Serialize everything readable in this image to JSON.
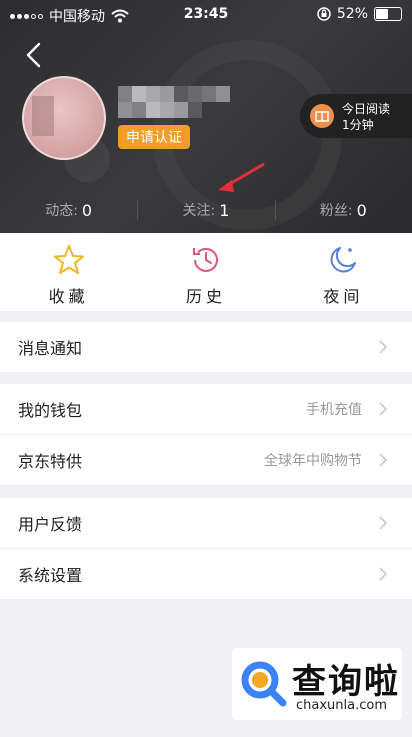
{
  "status_bar": {
    "carrier": "中国移动",
    "time": "23:45",
    "battery": "52%",
    "battery_level": 0.52
  },
  "profile": {
    "badge": "申请认证",
    "reading": {
      "line1": "今日阅读",
      "line2": "1分钟"
    }
  },
  "stats": [
    {
      "label": "动态:",
      "value": "0"
    },
    {
      "label": "关注:",
      "value": "1"
    },
    {
      "label": "粉丝:",
      "value": "0"
    }
  ],
  "quick": [
    {
      "label": "收藏",
      "icon": "star-icon"
    },
    {
      "label": "历史",
      "icon": "history-clock-icon"
    },
    {
      "label": "夜间",
      "icon": "night-moon-icon"
    }
  ],
  "menu": {
    "group1": [
      {
        "label": "消息通知",
        "hint": ""
      }
    ],
    "group2": [
      {
        "label": "我的钱包",
        "hint": "手机充值"
      },
      {
        "label": "京东特供",
        "hint": "全球年中购物节"
      }
    ],
    "group3": [
      {
        "label": "用户反馈",
        "hint": ""
      },
      {
        "label": "系统设置",
        "hint": ""
      }
    ]
  },
  "watermark": {
    "big": "查询啦",
    "small": "chaxunla.com"
  },
  "colors": {
    "header_bg": "#2d2d2f",
    "badge": "#f19d2a",
    "star": "#f0b429",
    "history": "#e0557a",
    "moon": "#5b7fd6"
  }
}
